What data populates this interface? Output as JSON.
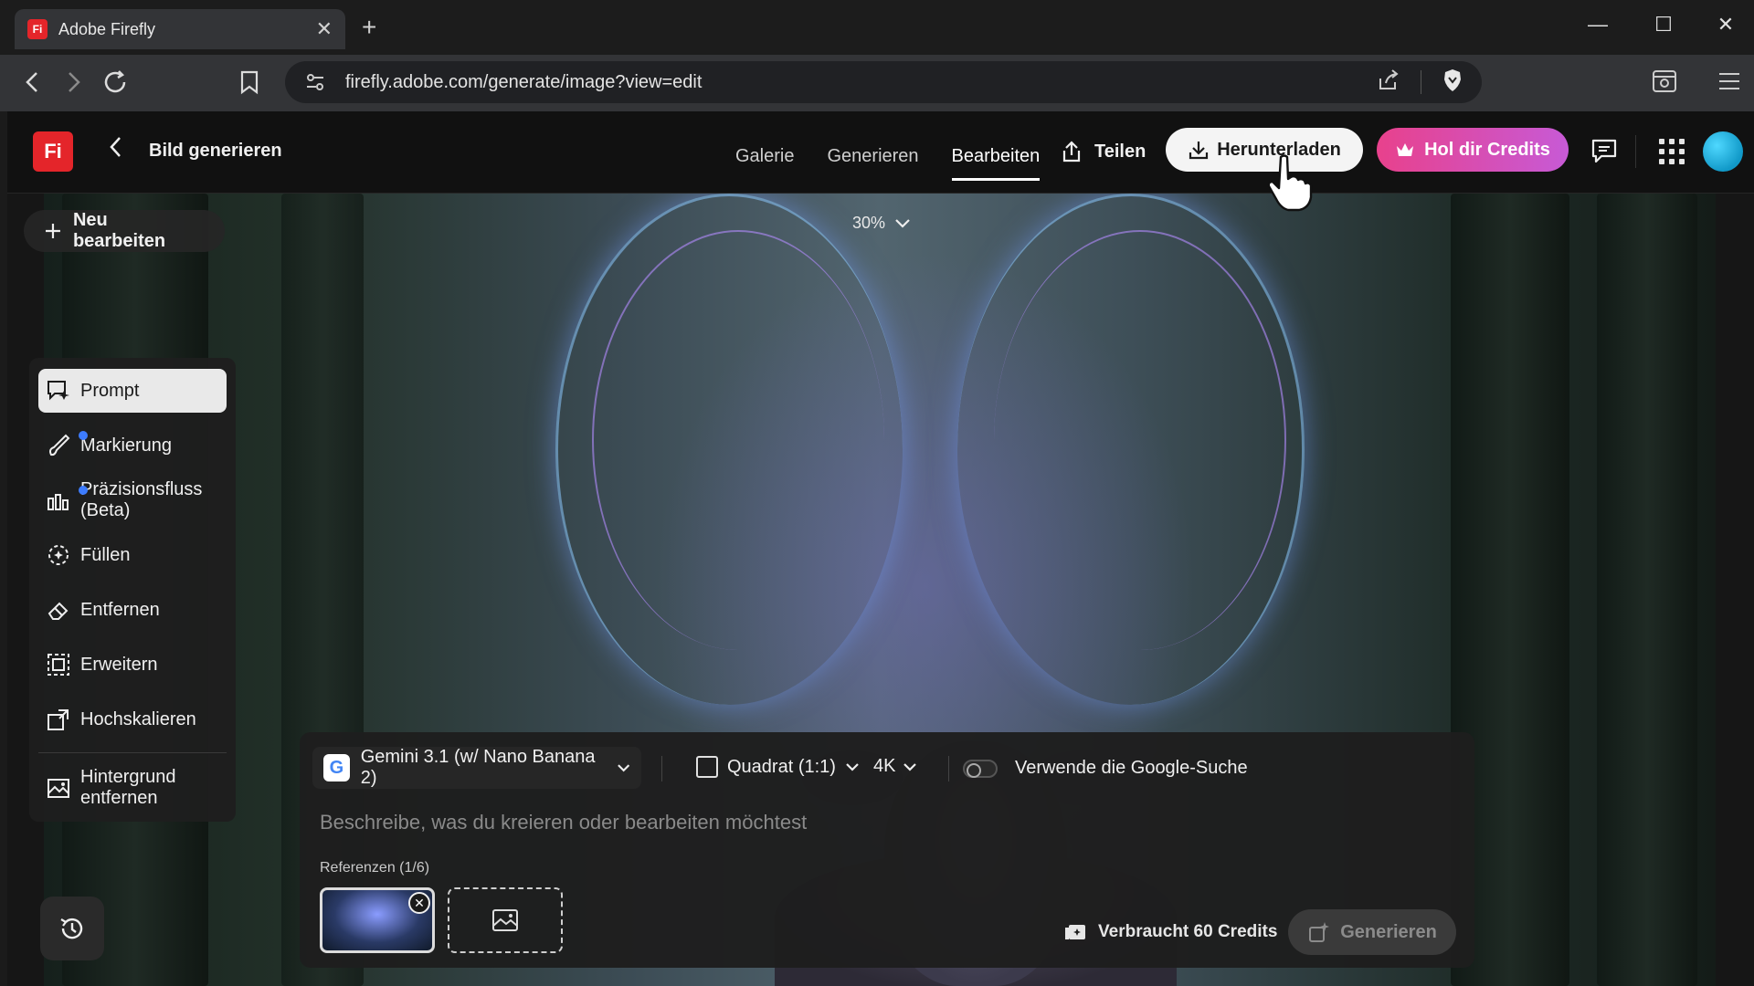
{
  "browser": {
    "tab_title": "Adobe Firefly",
    "tab_favicon": "Fi",
    "url": "firefly.adobe.com/generate/image?view=edit"
  },
  "header": {
    "logo": "Fi",
    "title": "Bild generieren",
    "nav": [
      {
        "label": "Galerie",
        "active": false
      },
      {
        "label": "Generieren",
        "active": false
      },
      {
        "label": "Bearbeiten",
        "active": true
      }
    ],
    "share_label": "Teilen",
    "download_label": "Herunterladen",
    "credits_label": "Hol dir Credits"
  },
  "canvas": {
    "zoom": "30%",
    "new_edit_label": "Neu bearbeiten"
  },
  "tools": [
    {
      "label": "Prompt",
      "icon": "prompt-icon",
      "active": true,
      "dot": false
    },
    {
      "label": "Markierung",
      "icon": "brush-icon",
      "active": false,
      "dot": true
    },
    {
      "label": "Präzisionsfluss (Beta)",
      "icon": "sliders-icon",
      "active": false,
      "dot": true
    },
    {
      "label": "Füllen",
      "icon": "fill-icon",
      "active": false,
      "dot": false
    },
    {
      "label": "Entfernen",
      "icon": "eraser-icon",
      "active": false,
      "dot": false
    },
    {
      "label": "Erweitern",
      "icon": "expand-icon",
      "active": false,
      "dot": false
    },
    {
      "label": "Hochskalieren",
      "icon": "upscale-icon",
      "active": false,
      "dot": false
    },
    {
      "label": "Hintergrund entfernen",
      "icon": "remove-background-icon",
      "active": false,
      "dot": false
    }
  ],
  "prompt": {
    "model": "Gemini 3.1 (w/ Nano Banana 2)",
    "aspect": "Quadrat (1:1)",
    "resolution": "4K",
    "google_search_label": "Verwende die Google-Suche",
    "google_search_enabled": false,
    "placeholder": "Beschreibe, was du kreieren oder bearbeiten möchtest",
    "value": "",
    "references_label": "Referenzen (1/6)",
    "credits_usage": "Verbraucht 60 Credits",
    "generate_label": "Generieren"
  },
  "colors": {
    "accent_red": "#e4252a",
    "credits_gradient_start": "#e8418c",
    "credits_gradient_end": "#c75ad6",
    "active_dot": "#3d7cff"
  }
}
